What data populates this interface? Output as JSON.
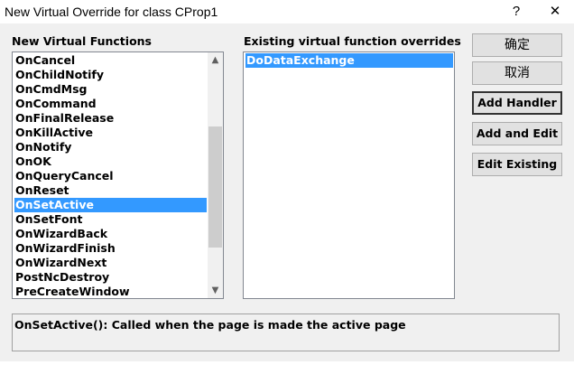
{
  "window": {
    "title": "New Virtual Override for class CProp1",
    "help_label": "?",
    "close_label": "✕"
  },
  "left": {
    "label": "New Virtual Functions",
    "items": [
      "OnCancel",
      "OnChildNotify",
      "OnCmdMsg",
      "OnCommand",
      "OnFinalRelease",
      "OnKillActive",
      "OnNotify",
      "OnOK",
      "OnQueryCancel",
      "OnReset",
      "OnSetActive",
      "OnSetFont",
      "OnWizardBack",
      "OnWizardFinish",
      "OnWizardNext",
      "PostNcDestroy",
      "PreCreateWindow"
    ],
    "selected": "OnSetActive"
  },
  "right": {
    "label": "Existing virtual function overrides",
    "items": [
      "DoDataExchange"
    ],
    "selected": "DoDataExchange"
  },
  "buttons": {
    "ok": "确定",
    "cancel": "取消",
    "add_handler": "Add Handler",
    "add_edit": "Add and Edit",
    "edit_existing": "Edit Existing"
  },
  "description": "OnSetActive():  Called when the page is made the active page",
  "icons": {
    "scroll_up": "up-arrow",
    "scroll_down": "down-arrow"
  }
}
